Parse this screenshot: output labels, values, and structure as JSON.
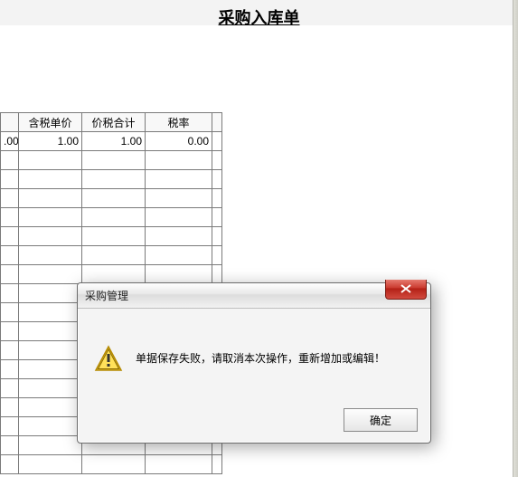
{
  "page": {
    "title": "采购入库单"
  },
  "grid": {
    "headers": {
      "c1": "含税单价",
      "c2": "价税合计",
      "c3": "税率",
      "c4": ""
    },
    "row0": {
      "c0": ".00",
      "c1": "1.00",
      "c2": "1.00",
      "c3": "0.00"
    }
  },
  "dialog": {
    "title": "采购管理",
    "message": "单据保存失败，请取消本次操作，重新增加或编辑！",
    "ok_label": "确定"
  }
}
